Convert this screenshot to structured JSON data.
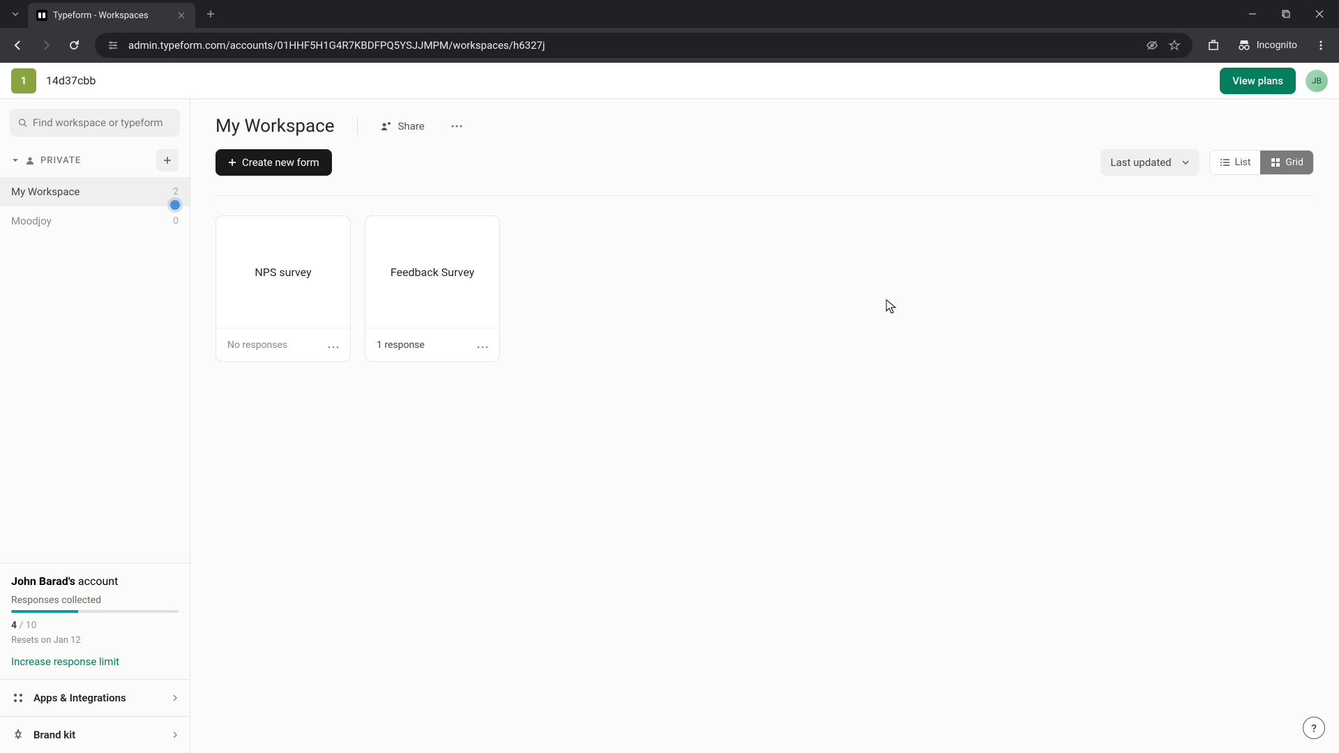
{
  "browser": {
    "tab_title": "Typeform - Workspaces",
    "url": "admin.typeform.com/accounts/01HHF5H1G4R7KBDFPQ5YSJJMPM/workspaces/h6327j",
    "incognito_label": "Incognito"
  },
  "header": {
    "org_initial": "1",
    "org_name": "14d37cbb",
    "view_plans": "View plans",
    "avatar_initials": "JB"
  },
  "sidebar": {
    "search_placeholder": "Find workspace or typeform",
    "section_label": "PRIVATE",
    "workspaces": [
      {
        "name": "My Workspace",
        "count": "2"
      },
      {
        "name": "Moodjoy",
        "count": "0"
      }
    ],
    "account": {
      "owner": "John Barad's",
      "suffix": " account",
      "responses_label": "Responses collected",
      "collected": "4",
      "limit_text": " / 10",
      "progress_pct": 40,
      "reset_text": "Resets on Jan 12",
      "increase_link": "Increase response limit"
    },
    "links": {
      "apps": "Apps & Integrations",
      "brand": "Brand kit"
    }
  },
  "content": {
    "title": "My Workspace",
    "share_label": "Share",
    "create_label": "Create new form",
    "sort_label": "Last updated",
    "list_label": "List",
    "grid_label": "Grid",
    "forms": [
      {
        "title": "NPS survey",
        "responses": "No responses",
        "has": false
      },
      {
        "title": "Feedback Survey",
        "responses": "1 response",
        "has": true
      }
    ]
  },
  "help_label": "?"
}
